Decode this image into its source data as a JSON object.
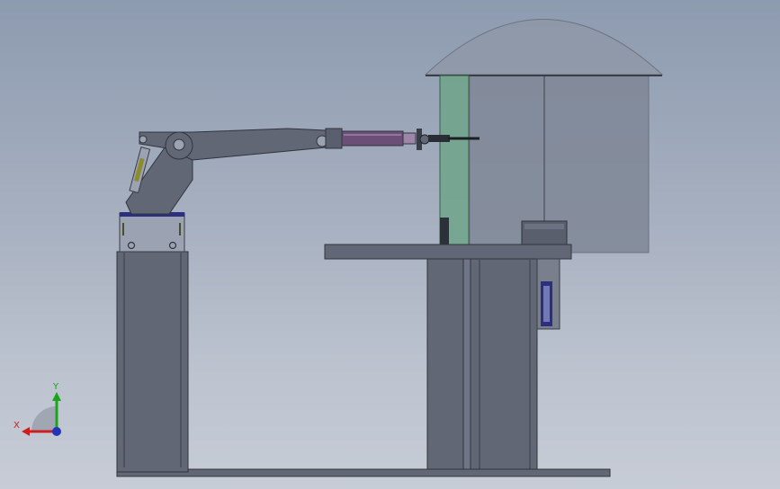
{
  "viewport": {
    "background_top": "#8d9bb0",
    "background_bottom": "#c7ccd6"
  },
  "model": {
    "part_fill": "#626775",
    "part_edge": "#3a3e48",
    "glass_fill": "#6fa58a",
    "cylinder_fill": "#6c4f78",
    "accent_blue": "#2b2f7d"
  },
  "triad": {
    "y_label": "Y",
    "x_label": "X",
    "y_color": "#1aa51a",
    "x_color": "#cc1e1e",
    "z_color": "#2334b8"
  }
}
